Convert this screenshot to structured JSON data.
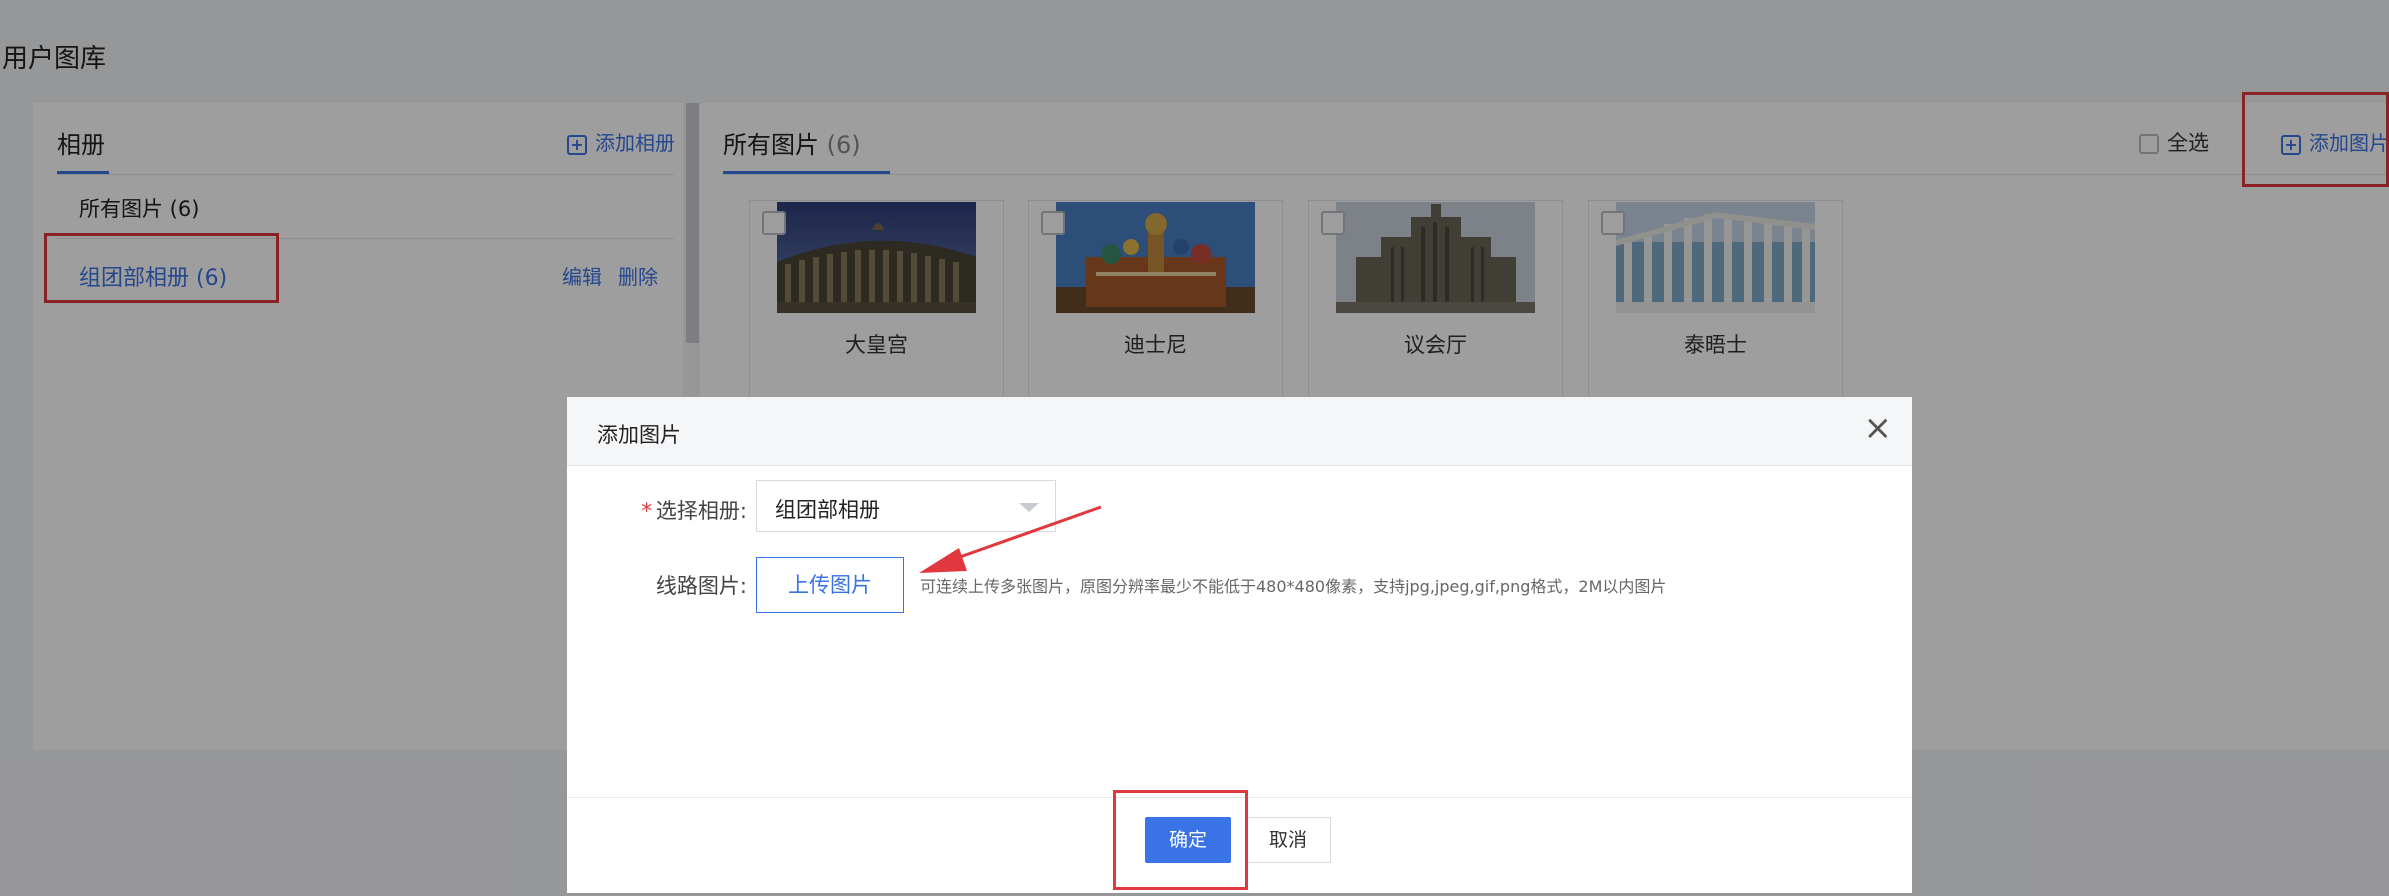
{
  "page": {
    "title": "用户图库"
  },
  "albums": {
    "tab_title": "相册",
    "add_label": "添加相册",
    "all_label": "所有图片 (6)",
    "items": [
      {
        "label": "组团部相册 (6)",
        "edit_label": "编辑",
        "delete_label": "删除"
      }
    ]
  },
  "photos": {
    "tab_title": "所有图片",
    "count": "(6)",
    "select_all_label": "全选",
    "add_label": "添加图片",
    "cards": [
      {
        "name": "大皇宫"
      },
      {
        "name": "迪士尼"
      },
      {
        "name": "议会厅"
      },
      {
        "name": "泰晤士"
      }
    ]
  },
  "modal": {
    "title": "添加图片",
    "close_icon": "close-icon",
    "album_label": "选择相册:",
    "album_required_mark": "*",
    "album_value": "组团部相册",
    "image_label": "线路图片:",
    "upload_label": "上传图片",
    "hint": "可连续上传多张图片，原图分辨率最少不能低于480*480像素，支持jpg,jpeg,gif,png格式，2M以内图片",
    "ok_label": "确定",
    "cancel_label": "取消"
  },
  "colors": {
    "accent": "#3a73e6",
    "highlight": "#e0383e"
  }
}
